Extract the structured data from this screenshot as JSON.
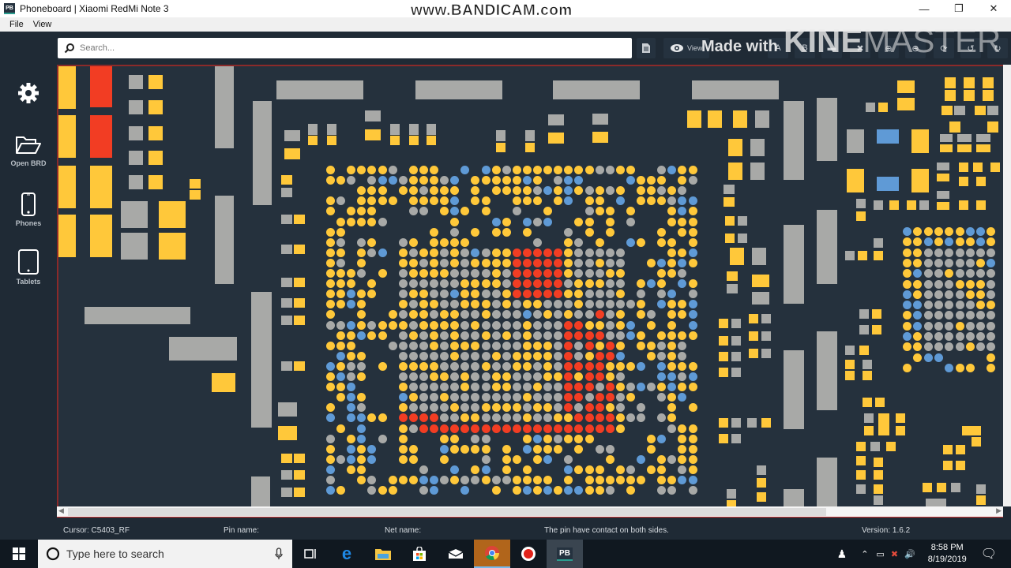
{
  "window": {
    "app_logo": "PB",
    "title": "Phoneboard | Xiaomi RedMi Note 3",
    "overlay_watermark": "www.BANDICAM.com",
    "controls": [
      "minimize",
      "restore",
      "close"
    ]
  },
  "menu": {
    "items": [
      {
        "label": "File"
      },
      {
        "label": "View"
      }
    ]
  },
  "toolbar": {
    "search_placeholder": "Search...",
    "search_value": "",
    "view_label": "View",
    "buttons": [
      "document-icon",
      "eye-icon",
      "flip-a-icon",
      "flip-b-icon",
      "layers-icon",
      "close-x-icon",
      "zoom-in-icon",
      "zoom-out-icon",
      "rotate-icon",
      "mirror-icon",
      "reset-icon"
    ],
    "watermark_made_with": "Made with",
    "watermark_brand_bold": "KINE",
    "watermark_brand_light": "MASTER"
  },
  "sidebar": {
    "items": [
      {
        "icon": "gear-icon",
        "label": ""
      },
      {
        "icon": "folder-open-icon",
        "label": "Open BRD"
      },
      {
        "icon": "phone-icon",
        "label": "Phones"
      },
      {
        "icon": "tablet-icon",
        "label": "Tablets"
      }
    ]
  },
  "board": {
    "colors": {
      "background": "#25313d",
      "top_side": "#ffc83a",
      "bottom_side": "#a8a9a7",
      "selected_net": "#f23d23",
      "ground": "#5f9ad6"
    }
  },
  "status": {
    "cursor": "Cursor: C5403_RF",
    "pin_name": "Pin name:",
    "net_name": "Net name:",
    "message": "The pin have contact on both sides.",
    "version": "Version: 1.6.2"
  },
  "taskbar": {
    "search_placeholder": "Type here to search",
    "apps": [
      "task-view-icon",
      "edge-icon",
      "file-explorer-icon",
      "store-icon",
      "mail-icon",
      "chrome-icon",
      "record-icon",
      "phoneboard-icon"
    ],
    "pb_label": "PB",
    "time": "8:58 PM",
    "date": "8/19/2019"
  }
}
